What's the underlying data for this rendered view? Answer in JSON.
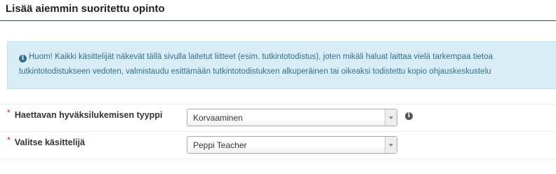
{
  "page_title": "Lisää aiemmin suoritettu opinto",
  "info_box": {
    "icon": "info-circle-icon",
    "line1": "Huom! Kaikki käsittelijät näkevät tällä sivulla laitetut liitteet (esim. tutkintotodistus), joten mikäli haluat laittaa vielä tarkempaa tietoa",
    "line2": "tutkintotodistukseen vedoten, valmistaudu esittämään tutkintotodistuksen alkuperäinen tai oikeaksi todistettu kopio ohjauskeskustelu"
  },
  "form": {
    "required_marker": "*",
    "fields": [
      {
        "label": "Haettavan hyväksilukemisen tyyppi",
        "selected_value": "Korvaaminen",
        "help_icon": "info-circle-icon"
      },
      {
        "label": "Valitse käsittelijä",
        "selected_value": "Peppi Teacher"
      }
    ]
  },
  "colors": {
    "info_background": "#d9edf7",
    "info_text": "#31708f",
    "required": "#c9302c",
    "title_rule": "#2f4f5f"
  }
}
